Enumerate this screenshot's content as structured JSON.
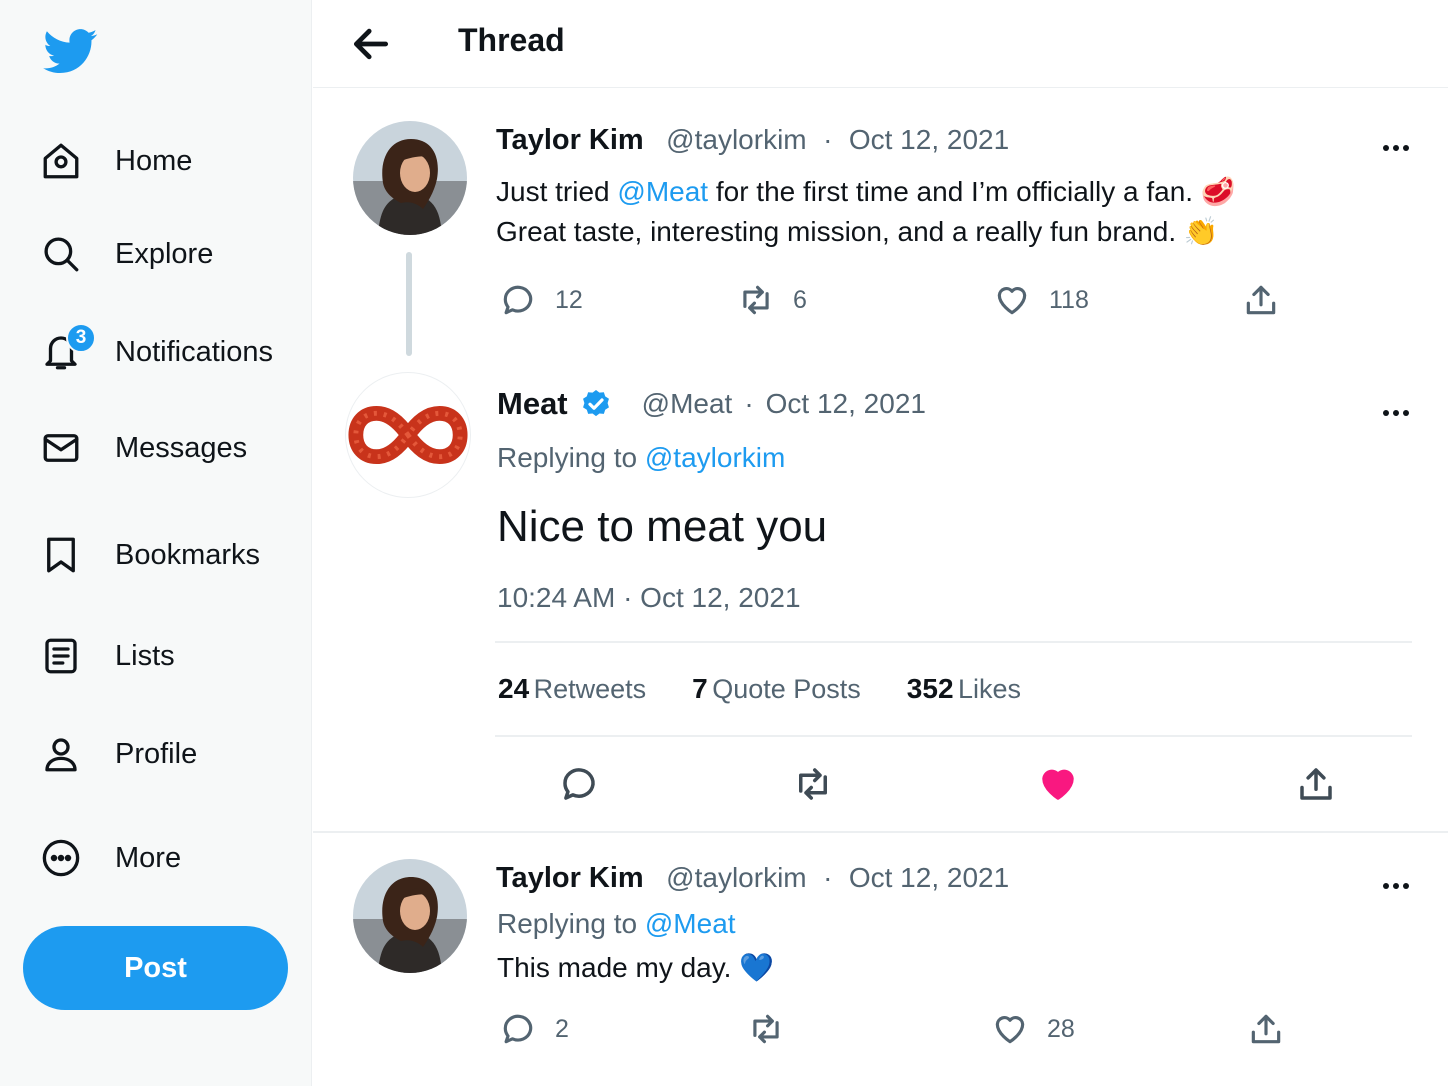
{
  "sidebar": {
    "logo": "twitter-bird-icon",
    "items": [
      {
        "label": "Home",
        "icon": "home-icon"
      },
      {
        "label": "Explore",
        "icon": "search-icon"
      },
      {
        "label": "Notifications",
        "icon": "bell-icon",
        "badge": "3"
      },
      {
        "label": "Messages",
        "icon": "envelope-icon"
      },
      {
        "label": "Bookmarks",
        "icon": "bookmark-icon"
      },
      {
        "label": "Lists",
        "icon": "list-icon"
      },
      {
        "label": "Profile",
        "icon": "person-icon"
      },
      {
        "label": "More",
        "icon": "more-circle-icon"
      }
    ],
    "post_label": "Post"
  },
  "header": {
    "title": "Thread"
  },
  "tweets": [
    {
      "name": "Taylor Kim",
      "handle": "@taylorkim",
      "sep": "·",
      "date": "Oct 12, 2021",
      "text_pre": "Just tried ",
      "mention": "@Meat",
      "text_post": " for the first time and I’m officially a fan. 🥩",
      "text_line2": "Great taste, interesting mission, and a really fun brand. 👏",
      "replies": "12",
      "retweets": "6",
      "likes": "118"
    },
    {
      "name": "Meat",
      "verified": true,
      "handle": "@Meat",
      "sep": "·",
      "date": "Oct 12, 2021",
      "replying_label": "Replying to",
      "replying_to": "@taylorkim",
      "text": "Nice to meat you",
      "timestamp": "10:24 AM · Oct 12, 2021",
      "stats": [
        {
          "value": "24",
          "label": "Retweets"
        },
        {
          "value": "7",
          "label": "Quote Posts"
        },
        {
          "value": "352",
          "label": "Likes"
        }
      ],
      "liked": true
    },
    {
      "name": "Taylor Kim",
      "handle": "@taylorkim",
      "sep": "·",
      "date": "Oct 12, 2021",
      "replying_label": "Replying to",
      "replying_to": "@Meat",
      "text": "This made my day. 💙",
      "replies": "2",
      "likes": "28"
    }
  ],
  "colors": {
    "accent": "#1d9bf0",
    "like": "#f91880",
    "text": "#0f1419",
    "muted": "#536471"
  }
}
